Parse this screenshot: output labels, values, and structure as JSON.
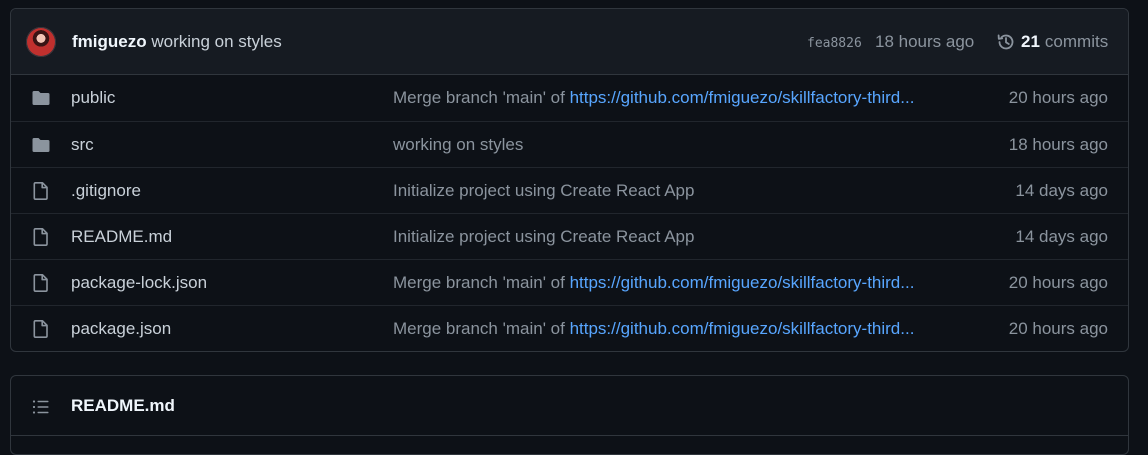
{
  "latest_commit": {
    "author": "fmiguezo",
    "message": "working on styles",
    "sha": "fea8826",
    "time": "18 hours ago",
    "commit_count": "21",
    "commits_label": "commits"
  },
  "files": [
    {
      "type": "folder",
      "name": "public",
      "msg_prefix": "Merge branch 'main' of ",
      "msg_link": "https://github.com/fmiguezo/skillfactory-third...",
      "age": "20 hours ago"
    },
    {
      "type": "folder",
      "name": "src",
      "msg_prefix": "working on styles",
      "msg_link": "",
      "age": "18 hours ago"
    },
    {
      "type": "file",
      "name": ".gitignore",
      "msg_prefix": "Initialize project using Create React App",
      "msg_link": "",
      "age": "14 days ago"
    },
    {
      "type": "file",
      "name": "README.md",
      "msg_prefix": "Initialize project using Create React App",
      "msg_link": "",
      "age": "14 days ago"
    },
    {
      "type": "file",
      "name": "package-lock.json",
      "msg_prefix": "Merge branch 'main' of ",
      "msg_link": "https://github.com/fmiguezo/skillfactory-third...",
      "age": "20 hours ago"
    },
    {
      "type": "file",
      "name": "package.json",
      "msg_prefix": "Merge branch 'main' of ",
      "msg_link": "https://github.com/fmiguezo/skillfactory-third...",
      "age": "20 hours ago"
    }
  ],
  "readme": {
    "title": "README.md",
    "icon": "list-icon"
  },
  "icons": {
    "folder": "folder-icon",
    "file": "file-icon",
    "history": "history-icon"
  },
  "colors": {
    "background": "#0d1117",
    "header": "#161b22",
    "border": "#30363d",
    "link": "#58a6ff",
    "muted": "#8b949e"
  }
}
